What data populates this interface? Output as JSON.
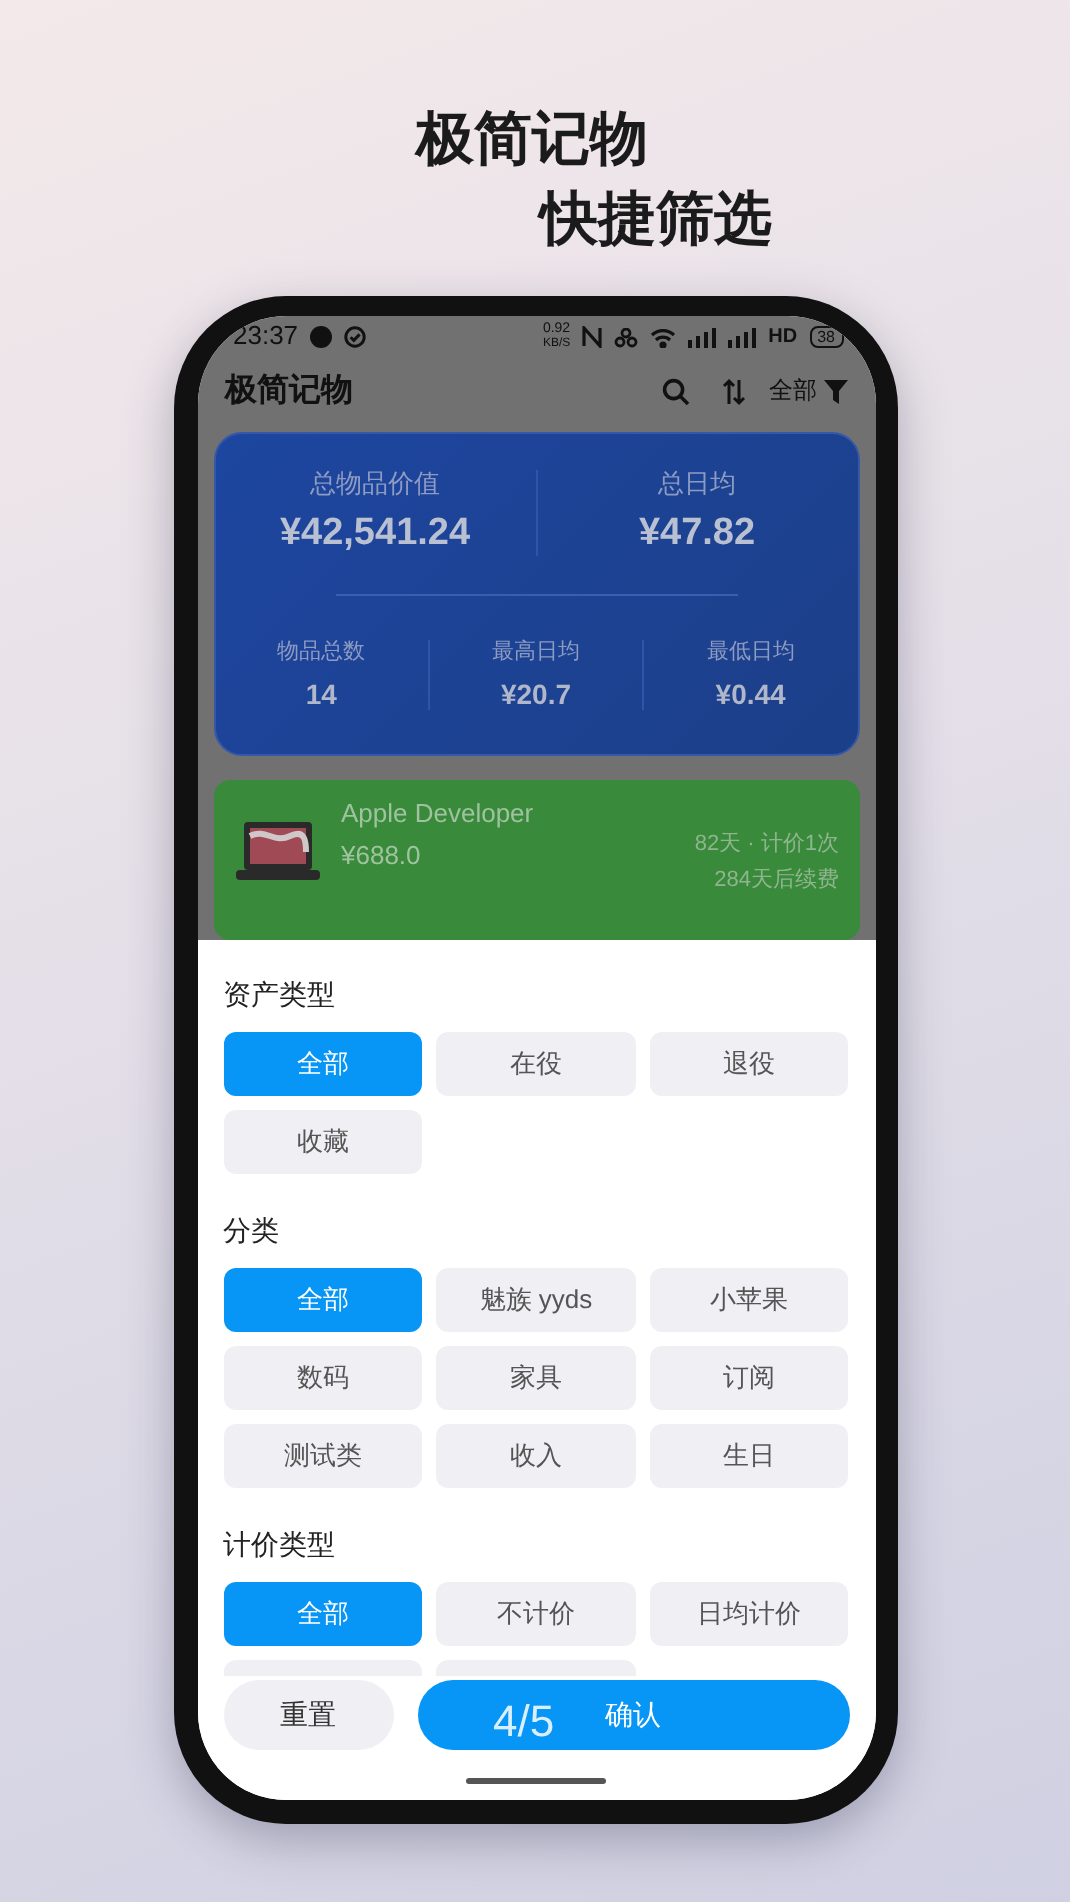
{
  "headline": {
    "line_1": "极简记物",
    "line_2": "快捷筛选"
  },
  "status_bar": {
    "time": "23:37",
    "speed_value": "0.92",
    "speed_unit": "KB/S",
    "hd": "HD",
    "battery": "38"
  },
  "app_bar": {
    "title": "极简记物",
    "filter_label": "全部"
  },
  "summary": {
    "top": [
      {
        "label": "总物品价值",
        "value": "¥42,541.24"
      },
      {
        "label": "总日均",
        "value": "¥47.82"
      }
    ],
    "bottom": [
      {
        "label": "物品总数",
        "value": "14"
      },
      {
        "label": "最高日均",
        "value": "¥20.7"
      },
      {
        "label": "最低日均",
        "value": "¥0.44"
      }
    ]
  },
  "items": [
    {
      "name": "Apple Developer",
      "price": "¥688.0",
      "usage": "82天 · 计价1次",
      "renewal": "284天后续费"
    }
  ],
  "filter_sheet": {
    "sections": [
      {
        "title": "资产类型",
        "options": [
          {
            "label": "全部",
            "selected": true
          },
          {
            "label": "在役",
            "selected": false
          },
          {
            "label": "退役",
            "selected": false
          },
          {
            "label": "收藏",
            "selected": false
          }
        ]
      },
      {
        "title": "分类",
        "options": [
          {
            "label": "全部",
            "selected": true
          },
          {
            "label": "魅族 yyds",
            "selected": false
          },
          {
            "label": "小苹果",
            "selected": false
          },
          {
            "label": "数码",
            "selected": false
          },
          {
            "label": "家具",
            "selected": false
          },
          {
            "label": "订阅",
            "selected": false
          },
          {
            "label": "测试类",
            "selected": false
          },
          {
            "label": "收入",
            "selected": false
          },
          {
            "label": "生日",
            "selected": false
          }
        ]
      },
      {
        "title": "计价类型",
        "options": [
          {
            "label": "全部",
            "selected": true
          },
          {
            "label": "不计价",
            "selected": false
          },
          {
            "label": "日均计价",
            "selected": false
          },
          {
            "selected": false
          },
          {
            "selected": false
          }
        ]
      }
    ],
    "reset_button": "重置",
    "confirm_button": "确认"
  },
  "page_indicator": "4/5"
}
